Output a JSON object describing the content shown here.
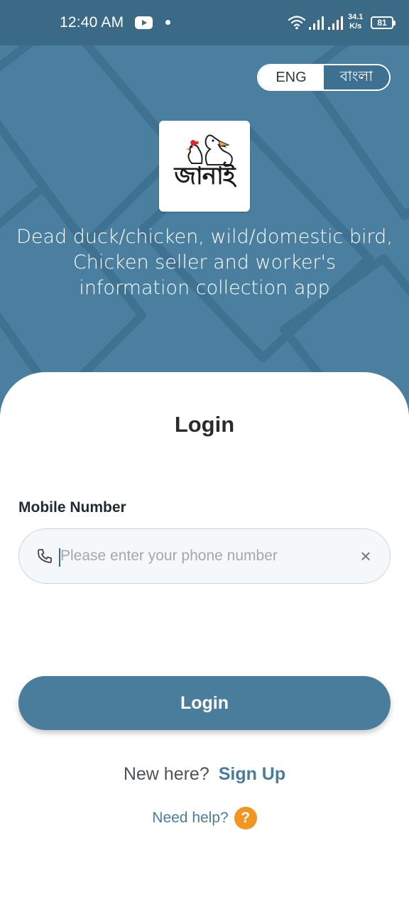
{
  "status_bar": {
    "time": "12:40 AM",
    "net_speed_value": "34.1",
    "net_speed_unit": "K/s",
    "battery": "81",
    "icons": [
      "youtube-icon",
      "notification-dot-icon",
      "wifi-icon",
      "signal-icon",
      "signal-icon",
      "battery-icon"
    ]
  },
  "language_toggle": {
    "options": [
      "ENG",
      "বাংলা"
    ],
    "selected": "ENG"
  },
  "logo": {
    "wordmark": "জানাই"
  },
  "tagline": {
    "line1": "Dead duck/chicken, wild/domestic bird,",
    "line2": "Chicken seller and worker's",
    "line3": "information collection app"
  },
  "login_form": {
    "title": "Login",
    "mobile_label": "Mobile Number",
    "phone_placeholder": "Please enter your phone number",
    "phone_value": "",
    "clear_symbol": "×",
    "login_button": "Login"
  },
  "footer": {
    "new_here": "New here?",
    "sign_up": "Sign Up",
    "need_help": "Need help?",
    "help_symbol": "?"
  },
  "colors": {
    "primary": "#4a7d9c",
    "status_bar": "#3a6a85",
    "help_badge": "#f29523"
  }
}
